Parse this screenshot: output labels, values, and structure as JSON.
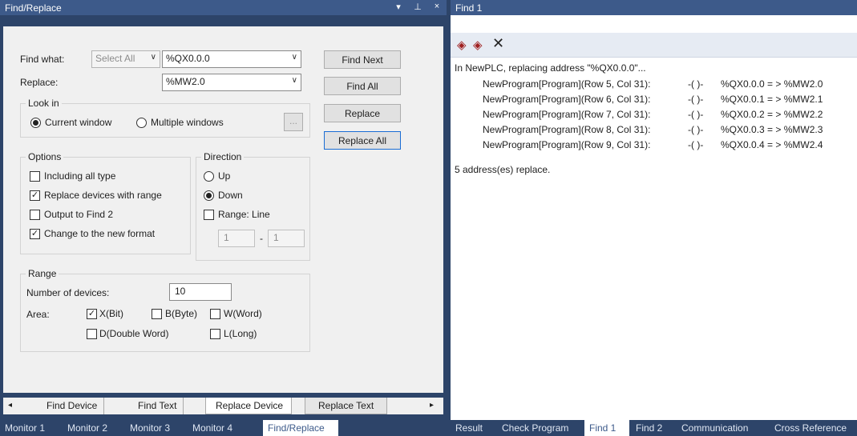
{
  "left_pane": {
    "title": "Find/Replace",
    "pin_menu_icon": "▾",
    "pin_icon": "ꟷ",
    "close_icon": "×"
  },
  "find": {
    "label": "Find what:",
    "select": "Select All",
    "value": "%QX0.0.0"
  },
  "replace": {
    "label": "Replace:",
    "value": "%MW2.0"
  },
  "buttons": {
    "find_next": "Find Next",
    "find_all": "Find All",
    "replace": "Replace",
    "replace_all": "Replace All"
  },
  "look_in": {
    "title": "Look in",
    "current": "Current window",
    "multiple": "Multiple windows",
    "browse": "..."
  },
  "options": {
    "title": "Options",
    "including_all_type": "Including all type",
    "replace_devices_range": "Replace devices with range",
    "output_find2": "Output to Find 2",
    "change_new_format": "Change to the new format",
    "states": {
      "including_all_type": false,
      "replace_devices_range": true,
      "output_find2": false,
      "change_new_format": true
    }
  },
  "direction": {
    "title": "Direction",
    "up": "Up",
    "down": "Down",
    "range_line": "Range: Line",
    "from": "1",
    "dash": "-",
    "to": "1",
    "selected": "Down"
  },
  "range": {
    "title": "Range",
    "num_devices_label": "Number of devices:",
    "num_devices": "10",
    "area_label": "Area:",
    "x_bit": "X(Bit)",
    "b_byte": "B(Byte)",
    "w_word": "W(Word)",
    "d_dword": "D(Double Word)",
    "l_long": "L(Long)",
    "states": {
      "x_bit": true,
      "b_byte": false,
      "w_word": false,
      "d_dword": false,
      "l_long": false
    }
  },
  "inner_tabs": [
    "Find Device",
    "Find Text",
    "Replace Device",
    "Replace Text"
  ],
  "inner_tab_active": "Replace Device",
  "left_bottom_tabs": [
    "Monitor 1",
    "Monitor 2",
    "Monitor 3",
    "Monitor 4",
    "Find/Replace"
  ],
  "right_pane": {
    "title": "Find 1"
  },
  "results": {
    "header": "In NewPLC, replacing address \"%QX0.0.0\"...",
    "rows": [
      {
        "loc": "NewProgram[Program](Row 5, Col 31):",
        "sym": "-( )-",
        "change": "%QX0.0.0 = > %MW2.0"
      },
      {
        "loc": "NewProgram[Program](Row 6, Col 31):",
        "sym": "-( )-",
        "change": "%QX0.0.1 = > %MW2.1"
      },
      {
        "loc": "NewProgram[Program](Row 7, Col 31):",
        "sym": "-( )-",
        "change": "%QX0.0.2 = > %MW2.2"
      },
      {
        "loc": "NewProgram[Program](Row 8, Col 31):",
        "sym": "-( )-",
        "change": "%QX0.0.3 = > %MW2.3"
      },
      {
        "loc": "NewProgram[Program](Row 9, Col 31):",
        "sym": "-( )-",
        "change": "%QX0.0.4 = > %MW2.4"
      }
    ],
    "footer": "5 address(es) replace."
  },
  "right_bottom_tabs": [
    "Result",
    "Check Program",
    "Find 1",
    "Find 2",
    "Communication",
    "Cross Reference"
  ],
  "right_bottom_active": "Find 1",
  "left_bottom_active": "Find/Replace"
}
